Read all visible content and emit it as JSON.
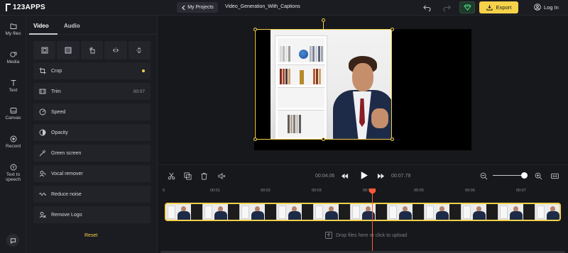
{
  "topbar": {
    "logo_text": "123APPS",
    "back_label": "My Projects",
    "file_name": "Video_Generation_With_Captions",
    "export_label": "Export",
    "login_label": "Log In"
  },
  "rail": {
    "items": [
      {
        "label": "My files",
        "icon": "folder-icon"
      },
      {
        "label": "Media",
        "icon": "media-icon"
      },
      {
        "label": "Text",
        "icon": "text-icon"
      },
      {
        "label": "Canvas",
        "icon": "canvas-icon"
      },
      {
        "label": "Record",
        "icon": "record-icon"
      },
      {
        "label": "Text to speech",
        "icon": "tts-icon"
      }
    ]
  },
  "panel": {
    "tabs": [
      "Video",
      "Audio"
    ],
    "tools": [
      "fit-icon",
      "fill-icon",
      "rotate-icon",
      "flip-horizontal-icon",
      "flip-vertical-icon"
    ],
    "options": [
      {
        "label": "Crop",
        "icon": "crop-icon",
        "value": ""
      },
      {
        "label": "Trim",
        "icon": "trim-icon",
        "value": "00:07"
      },
      {
        "label": "Speed",
        "icon": "speed-icon",
        "value": ""
      },
      {
        "label": "Opacity",
        "icon": "opacity-icon",
        "value": ""
      },
      {
        "label": "Green screen",
        "icon": "green-screen-icon",
        "value": ""
      },
      {
        "label": "Vocal remover",
        "icon": "vocal-remover-icon",
        "value": ""
      },
      {
        "label": "Reduce noise",
        "icon": "noise-icon",
        "value": ""
      },
      {
        "label": "Remove Logo",
        "icon": "remove-logo-icon",
        "value": ""
      }
    ],
    "reset_label": "Reset"
  },
  "player": {
    "current_time": "00:04.06",
    "total_time": "00:07.79"
  },
  "timeline": {
    "ticks": [
      "0",
      "00:01",
      "00:02",
      "00:03",
      "00:04",
      "00:05",
      "00:06",
      "00:07"
    ],
    "drop_label": "Drop files here or click to upload"
  },
  "colors": {
    "accent": "#f6d24a",
    "playhead": "#ff5a36",
    "background": "#17181c"
  }
}
